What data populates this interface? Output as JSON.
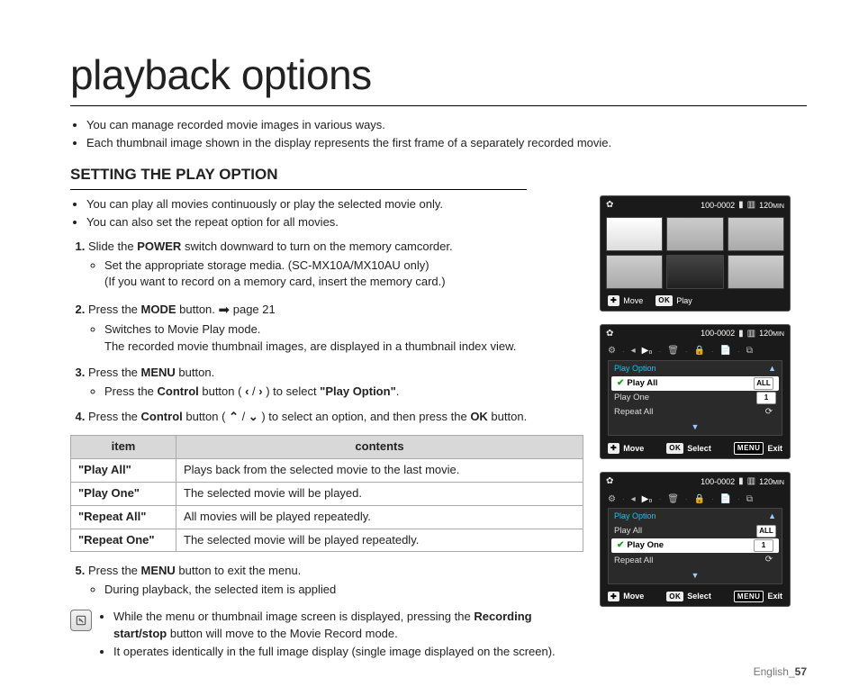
{
  "page": {
    "title": "playback options",
    "intro": [
      "You can manage recorded movie images in various ways.",
      "Each thumbnail image shown in the display represents the first frame of a separately recorded movie."
    ],
    "section_heading": "SETTING THE PLAY OPTION",
    "sub_intro": [
      "You can play all movies continuously or play the selected movie only.",
      "You can also set the repeat option for all movies."
    ],
    "steps": {
      "s1_a": "Slide the ",
      "s1_b": "POWER",
      "s1_c": " switch downward to turn on the memory camcorder.",
      "s1_sub1": "Set the appropriate storage media. (SC-MX10A/MX10AU only)",
      "s1_sub1b": "(If you want to record on a memory card, insert the memory card.)",
      "s2_a": "Press the ",
      "s2_b": "MODE",
      "s2_c": " button.",
      "s2_page_ref": "page 21",
      "s2_sub1": "Switches to Movie Play mode.",
      "s2_sub2": "The recorded movie thumbnail images, are displayed in a thumbnail index view.",
      "s3_a": "Press the ",
      "s3_b": "MENU",
      "s3_c": " button.",
      "s3_sub_a": "Press the ",
      "s3_sub_b": "Control",
      "s3_sub_c": " button ( ",
      "s3_sub_d": " ) to select ",
      "s3_sub_e": "\"Play Option\"",
      "s3_sub_f": ".",
      "s4_a": "Press the ",
      "s4_b": "Control",
      "s4_c": " button ( ",
      "s4_d": " ) to select an option, and then press the ",
      "s4_e": "OK",
      "s4_f": " button.",
      "s5_a": "Press the ",
      "s5_b": "MENU",
      "s5_c": " button to exit the menu.",
      "s5_sub1": "During playback, the selected item is applied"
    },
    "table": {
      "head_item": "item",
      "head_contents": "contents",
      "rows": [
        {
          "item": "\"Play All\"",
          "desc": "Plays back from the selected movie to the last movie."
        },
        {
          "item": "\"Play One\"",
          "desc": "The selected movie will be played."
        },
        {
          "item": "\"Repeat All\"",
          "desc": "All movies will be played repeatedly."
        },
        {
          "item": "\"Repeat One\"",
          "desc": "The selected movie will be played repeatedly."
        }
      ]
    },
    "notes": [
      "While the menu or thumbnail image screen is displayed, pressing the Recording start/stop button will move to the Movie Record mode.",
      "It operates identically in the full image display (single image displayed on the screen)."
    ],
    "note_bold": "Recording start/stop",
    "footer_lang": "English_",
    "footer_pagenum": "57"
  },
  "lcd_common": {
    "file_counter": "100-0002",
    "min_label": "120",
    "min_unit": "MIN"
  },
  "lcd1": {
    "foot_move": "Move",
    "foot_play": "Play"
  },
  "lcd_menu": {
    "header": "Play Option",
    "items": {
      "play_all": {
        "label": "Play All",
        "icon_text": "ALL"
      },
      "play_one": {
        "label": "Play One",
        "icon_text": "1"
      },
      "repeat_all": {
        "label": "Repeat All",
        "icon_text": "⟳"
      }
    },
    "foot_move": "Move",
    "foot_select": "Select",
    "foot_exit": "Exit",
    "ok_badge": "OK",
    "menu_badge": "MENU",
    "move_badge": "✚"
  }
}
